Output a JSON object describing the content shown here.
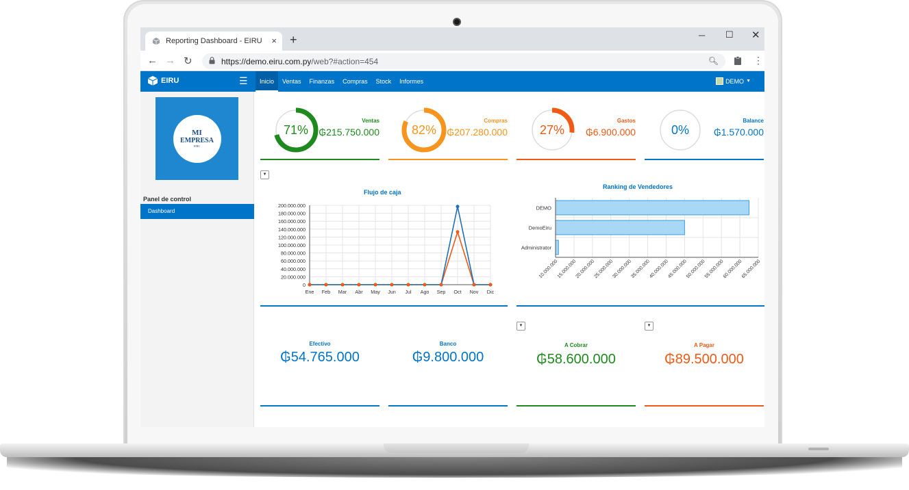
{
  "browser": {
    "tab_title": "Reporting Dashboard - EIRU",
    "url_prefix": "https://",
    "url_host": "demo.eiru.com.py",
    "url_path": "/web?#action=454",
    "new_tab_glyph": "+",
    "close_glyph": "×"
  },
  "app": {
    "brand": "EIRU",
    "menu": [
      "Inicio",
      "Ventas",
      "Finanzas",
      "Compras",
      "Stock",
      "Informes"
    ],
    "active_menu": "Inicio",
    "user": "DEMO",
    "accent": "#0074c8"
  },
  "sidebar": {
    "logo_line1": "MI",
    "logo_line2": "EMPRESA",
    "logo_line3": "EIRU",
    "section_title": "Panel de control",
    "items": [
      "Dashboard"
    ]
  },
  "kpis": [
    {
      "label": "Ventas",
      "percent": "71%",
      "fraction": 0.71,
      "value": "₲215.750.000",
      "color": "#1e8a1e"
    },
    {
      "label": "Compras",
      "percent": "82%",
      "fraction": 0.82,
      "value": "₲207.280.000",
      "color": "#f7941d"
    },
    {
      "label": "Gastos",
      "percent": "27%",
      "fraction": 0.27,
      "value": "₲6.900.000",
      "color": "#f05a14"
    },
    {
      "label": "Balance",
      "percent": "0%",
      "fraction": 0.0,
      "value": "₲1.570.000",
      "color": "#0074c8"
    }
  ],
  "chart_data": [
    {
      "type": "line",
      "title": "Flujo de caja",
      "categories": [
        "Ene",
        "Feb",
        "Mar",
        "Abr",
        "May",
        "Jun",
        "Jul",
        "Ago",
        "Sep",
        "Oct",
        "Nov",
        "Dic"
      ],
      "yticks": [
        "0",
        "20.000.000",
        "40.000.000",
        "60.000.000",
        "80.000.000",
        "100.000.000",
        "120.000.000",
        "140.000.000",
        "160.000.000",
        "180.000.000",
        "200.000.000"
      ],
      "ylim": [
        0,
        200000000
      ],
      "series": [
        {
          "color": "#1f6fb5",
          "values": [
            0,
            0,
            0,
            0,
            0,
            0,
            0,
            0,
            0,
            197000000,
            0,
            0
          ]
        },
        {
          "color": "#f05a14",
          "values": [
            0,
            0,
            0,
            0,
            0,
            0,
            0,
            0,
            0,
            133000000,
            0,
            0
          ]
        }
      ],
      "grid": true
    },
    {
      "type": "bar",
      "orientation": "horizontal",
      "title": "Ranking de Vendedores",
      "categories": [
        "DEMO",
        "DemoEiru",
        "Administrator"
      ],
      "values": [
        62500000,
        45000000,
        10800000
      ],
      "xticks": [
        "10.000.000",
        "15.000.000",
        "20.000.000",
        "25.000.000",
        "30.000.000",
        "35.000.000",
        "40.000.000",
        "45.000.000",
        "50.000.000",
        "55.000.000",
        "60.000.000",
        "65.000.000"
      ],
      "xlim": [
        10000000,
        65000000
      ],
      "bar_color": "#a8d8f5",
      "bar_border": "#3aa0e0",
      "grid": true
    }
  ],
  "totals": [
    {
      "label": "Efectivo",
      "value": "₲54.765.000",
      "color": "#0074c8"
    },
    {
      "label": "Banco",
      "value": "₲9.800.000",
      "color": "#0074c8"
    },
    {
      "label": "A Cobrar",
      "value": "₲58.600.000",
      "color": "#1e8a1e"
    },
    {
      "label": "A Pagar",
      "value": "₲89.500.000",
      "color": "#f05a14"
    }
  ],
  "dropdown_glyph": "▼"
}
